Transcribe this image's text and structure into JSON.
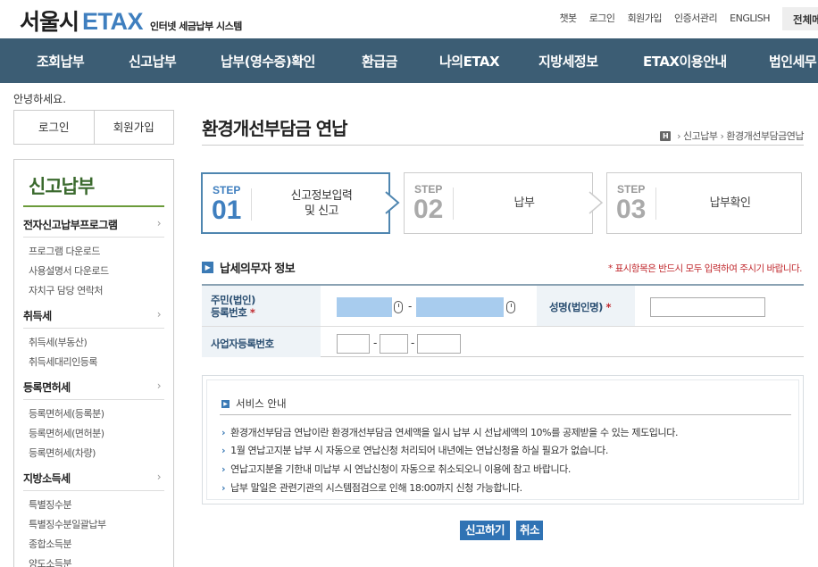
{
  "header": {
    "logo_city": "서울시",
    "logo_etax": "ETAX",
    "logo_sub": "인터넷 세금납부 시스템",
    "util_links": [
      "챗봇",
      "로그인",
      "회원가입",
      "인증서관리",
      "ENGLISH"
    ],
    "util_full": "전체메뉴"
  },
  "gnb": [
    "조회납부",
    "신고납부",
    "납부(영수증)확인",
    "환급금",
    "나의ETAX",
    "지방세정보",
    "ETAX이용안내",
    "법인세무"
  ],
  "sidebar": {
    "greeting": "안녕하세요.",
    "login": "로그인",
    "join": "회원가입",
    "title": "신고납부",
    "groups": [
      {
        "label": "전자신고납부프로그램",
        "items": [
          "프로그램 다운로드",
          "사용설명서 다운로드",
          "자치구 담당 연락처"
        ]
      },
      {
        "label": "취득세",
        "items": [
          "취득세(부동산)",
          "취득세대리인등록"
        ]
      },
      {
        "label": "등록면허세",
        "items": [
          "등록면허세(등록분)",
          "등록면허세(면허분)",
          "등록면허세(차량)"
        ]
      },
      {
        "label": "지방소득세",
        "items": [
          "특별징수분",
          "특별징수분일괄납부",
          "종합소득분",
          "양도소득분"
        ]
      }
    ]
  },
  "main": {
    "title": "환경개선부담금 연납",
    "breadcrumb": {
      "home_icon_text": "H",
      "items": [
        "신고납부",
        "환경개선부담금연납"
      ]
    },
    "steps": [
      {
        "label": "STEP",
        "num": "01",
        "text": "신고정보입력\n및 신고",
        "active": true
      },
      {
        "label": "STEP",
        "num": "02",
        "text": "납부",
        "active": false
      },
      {
        "label": "STEP",
        "num": "03",
        "text": "납부확인",
        "active": false
      }
    ],
    "section_title": "납세의무자 정보",
    "required_note": "* 표시항목은 반드시 모두 입력하여 주시기 바랍니다.",
    "form": {
      "resident_label": "주민(법인)\n등록번호",
      "name_label": "성명(법인명)",
      "business_label": "사업자등록번호",
      "required_mark": "*",
      "dash": "-"
    },
    "notice": {
      "title": "서비스 안내",
      "items": [
        "환경개선부담금 연납이란 환경개선부담금 연세액을 일시 납부 시 선납세액의 10%를 공제받을 수 있는 제도입니다.",
        "1월 연납고지분 납부 시 자동으로 연납신청 처리되어 내년에는 연납신청을 하실 필요가 없습니다.",
        "연납고지분을 기한내 미납부 시 연납신청이 자동으로 취소되오니 이용에 참고 바랍니다.",
        "납부 말일은 관련기관의 시스템점검으로 인해 18:00까지 신청 가능합니다."
      ]
    },
    "buttons": {
      "submit": "신고하기",
      "cancel": "취소"
    }
  },
  "colors": {
    "gnb_bg": "#3c5d74",
    "accent": "#3f7fbf",
    "button": "#3073b4",
    "sidebar_title": "#3b6a2e",
    "required": "#c0282d"
  }
}
